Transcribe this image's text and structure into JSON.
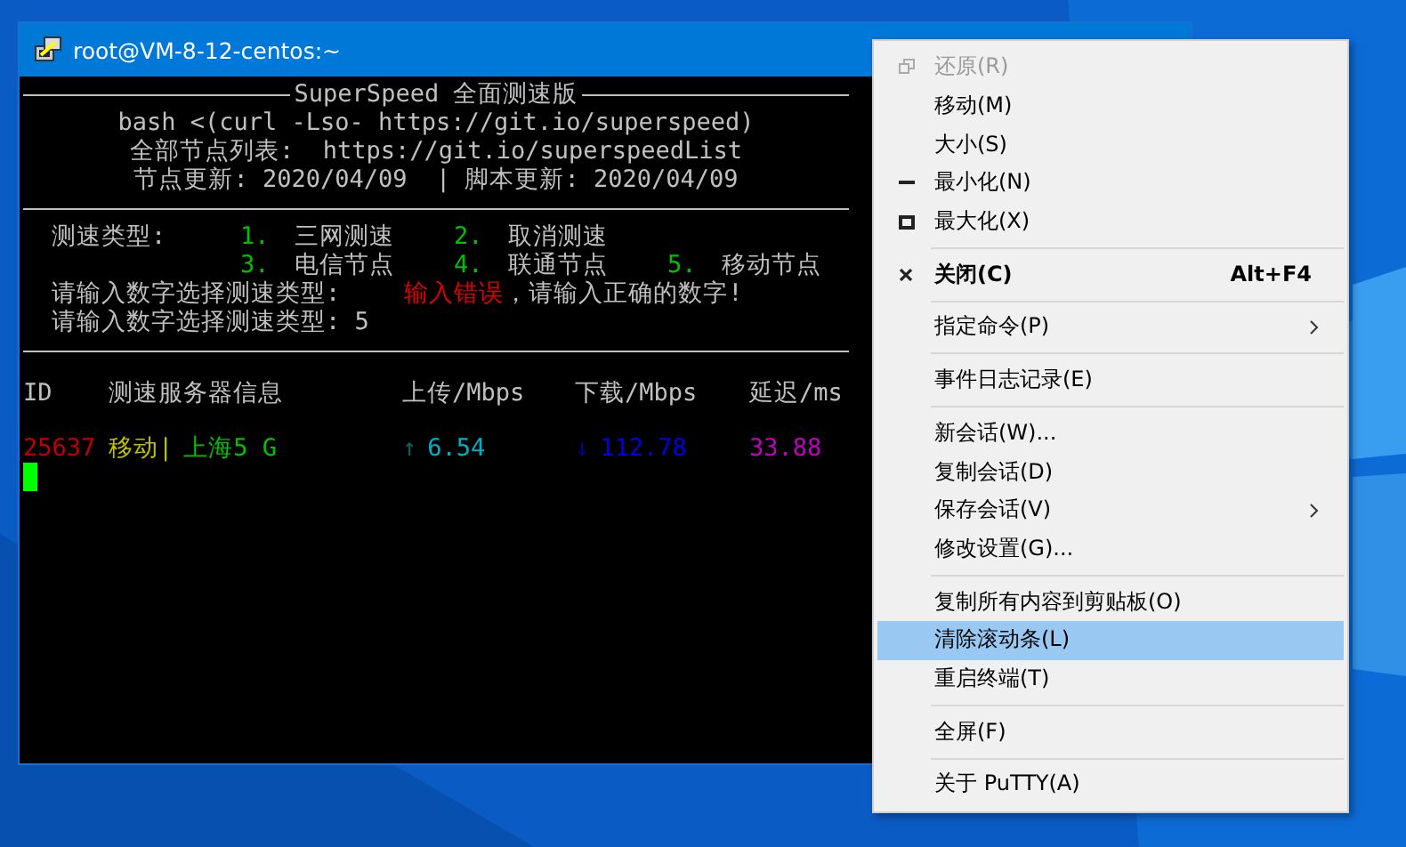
{
  "window": {
    "title": "root@VM-8-12-centos:~"
  },
  "terminal": {
    "banner": {
      "title": "SuperSpeed 全面测速版",
      "lines": [
        "bash <(curl -Lso- https://git.io/superspeed)",
        "全部节点列表:  https://git.io/superspeedList",
        "节点更新: 2020/04/09  | 脚本更新: 2020/04/09"
      ]
    },
    "speed_types": {
      "label": "测速类型:",
      "rows": [
        [
          {
            "number": "1.",
            "name": "三网测速"
          },
          {
            "number": "2.",
            "name": "取消测速"
          }
        ],
        [
          {
            "number": "3.",
            "name": "电信节点"
          },
          {
            "number": "4.",
            "name": "联通节点"
          },
          {
            "number": "5.",
            "name": "移动节点"
          }
        ]
      ]
    },
    "prompts": [
      [
        {
          "text": "请输入数字选择测速类型:",
          "color": "#c0c0c0"
        },
        {
          "text": "输入错误",
          "color": "#e00000"
        },
        {
          "text": "，请输入正确的数字!",
          "color": "#c0c0c0"
        }
      ],
      [
        {
          "text": "请输入数字选择测速类型: 5",
          "color": "#c0c0c0"
        }
      ]
    ],
    "table": {
      "columns": [
        "ID",
        "测速服务器信息",
        "上传/Mbps",
        "下载/Mbps",
        "延迟/ms"
      ],
      "rows": [
        [
          [
            {
              "text": "25637",
              "color": "#c00000"
            }
          ],
          [
            {
              "text": "移动|",
              "color": "#c0c000"
            },
            {
              "text": "上海5 G",
              "color": "#00c000"
            }
          ],
          [
            {
              "text": "↑",
              "color": "#106060"
            },
            {
              "text": "6.54",
              "color": "#00b0c0"
            }
          ],
          [
            {
              "text": "↓",
              "color": "#0000a0"
            },
            {
              "text": "112.78",
              "color": "#0000e0"
            }
          ],
          [
            {
              "text": "33.88",
              "color": "#c000c0"
            }
          ]
        ]
      ]
    }
  },
  "context_menu": [
    {
      "kind": "restore",
      "label": "还原(R)",
      "disabled": true,
      "selected": false
    },
    {
      "kind": "item",
      "label": "移动(M)",
      "disabled": false,
      "selected": false
    },
    {
      "kind": "item",
      "label": "大小(S)",
      "disabled": false,
      "selected": false
    },
    {
      "kind": "minimize",
      "label": "最小化(N)",
      "disabled": false,
      "selected": false
    },
    {
      "kind": "maximize",
      "label": "最大化(X)",
      "disabled": false,
      "selected": false
    },
    {
      "kind": "separator"
    },
    {
      "kind": "close",
      "label": "关闭(C)",
      "shortcut": "Alt+F4",
      "bold": true,
      "disabled": false,
      "selected": false
    },
    {
      "kind": "separator"
    },
    {
      "kind": "item",
      "label": "指定命令(P)",
      "submenu": true,
      "disabled": false,
      "selected": false
    },
    {
      "kind": "separator"
    },
    {
      "kind": "item",
      "label": "事件日志记录(E)",
      "disabled": false,
      "selected": false
    },
    {
      "kind": "separator"
    },
    {
      "kind": "item",
      "label": "新会话(W)...",
      "disabled": false,
      "selected": false
    },
    {
      "kind": "item",
      "label": "复制会话(D)",
      "disabled": false,
      "selected": false
    },
    {
      "kind": "item",
      "label": "保存会话(V)",
      "submenu": true,
      "disabled": false,
      "selected": false
    },
    {
      "kind": "item",
      "label": "修改设置(G)...",
      "disabled": false,
      "selected": false
    },
    {
      "kind": "separator"
    },
    {
      "kind": "item",
      "label": "复制所有内容到剪贴板(O)",
      "disabled": false,
      "selected": false
    },
    {
      "kind": "item",
      "label": "清除滚动条(L)",
      "disabled": false,
      "selected": true
    },
    {
      "kind": "item",
      "label": "重启终端(T)",
      "disabled": false,
      "selected": false
    },
    {
      "kind": "separator"
    },
    {
      "kind": "item",
      "label": "全屏(F)",
      "disabled": false,
      "selected": false
    },
    {
      "kind": "separator"
    },
    {
      "kind": "item",
      "label": "关于 PuTTY(A)",
      "disabled": false,
      "selected": false
    }
  ]
}
